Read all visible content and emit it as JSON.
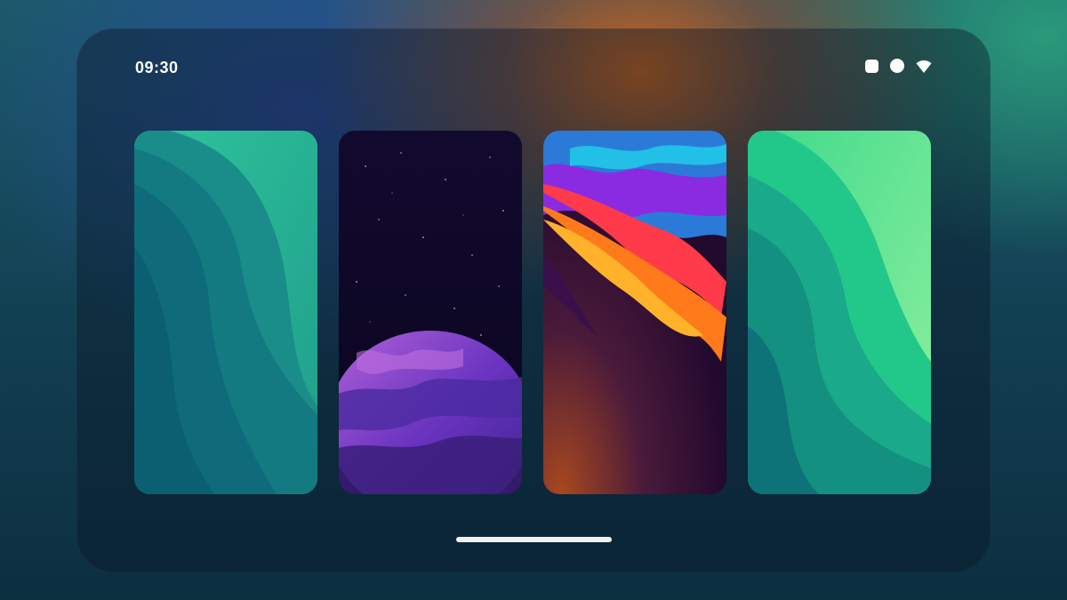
{
  "status_bar": {
    "time": "09:30",
    "icons": [
      "square-icon",
      "circle-icon",
      "wifi-icon"
    ]
  },
  "wallpapers": [
    {
      "name": "teal-waves",
      "colors": [
        "#0f6f79",
        "#1d9a8a",
        "#32c79a"
      ]
    },
    {
      "name": "purple-planet",
      "colors": [
        "#0e0827",
        "#5a2aa8",
        "#b25ad6"
      ]
    },
    {
      "name": "color-flames",
      "colors": [
        "#2a0c3a",
        "#ff6a1a",
        "#8a2be2"
      ]
    },
    {
      "name": "green-waves",
      "colors": [
        "#0c6f78",
        "#1fb48a",
        "#7fe6a0"
      ]
    }
  ],
  "colors": {
    "frame_bg": "#0a1626",
    "home_indicator": "#f2f2f2"
  }
}
